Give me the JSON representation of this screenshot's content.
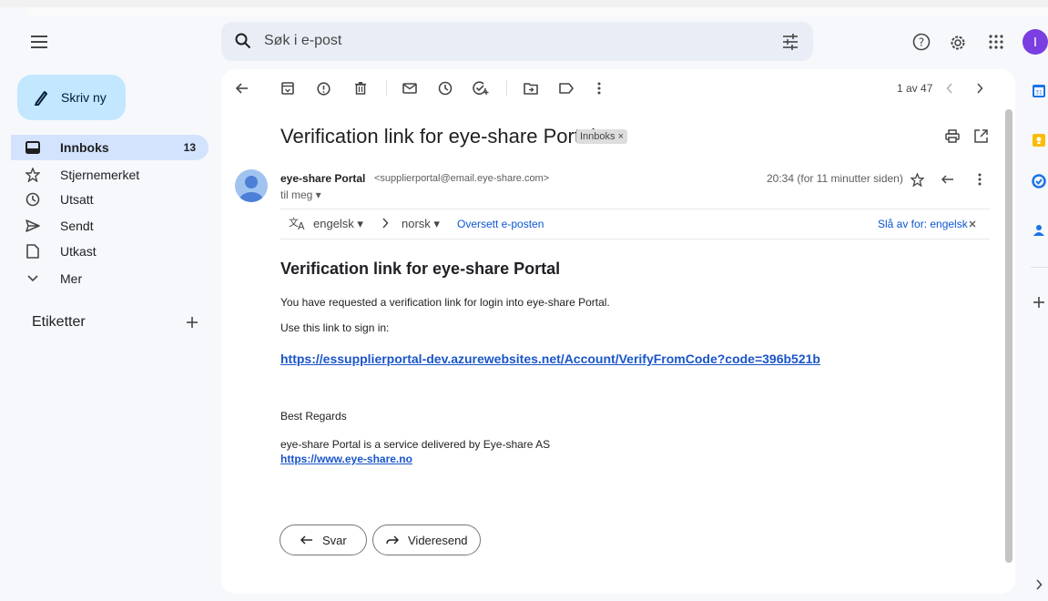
{
  "search": {
    "placeholder": "Søk i e-post"
  },
  "compose": {
    "label": "Skriv ny"
  },
  "nav": {
    "items": [
      {
        "label": "Innboks",
        "count": "13"
      },
      {
        "label": "Stjernemerket"
      },
      {
        "label": "Utsatt"
      },
      {
        "label": "Sendt"
      },
      {
        "label": "Utkast"
      },
      {
        "label": "Mer"
      }
    ],
    "labels_title": "Etiketter"
  },
  "account": {
    "initial": "I"
  },
  "toolbar": {
    "pager": "1 av 47"
  },
  "email": {
    "subject": "Verification link for eye-share Portal",
    "label_chip": "Innboks ×",
    "sender_name": "eye-share Portal",
    "sender_email": "<supplierportal@email.eye-share.com>",
    "to": "til meg ▾",
    "time": "20:34 (for 11 minutter siden)",
    "translate": {
      "from": "engelsk",
      "to": "norsk",
      "action": "Oversett e-posten",
      "disable": "Slå av for: engelsk"
    },
    "body": {
      "heading": "Verification link for eye-share Portal",
      "p1": "You have requested a verification link for login into eye-share Portal.",
      "p2": "Use this link to sign in:",
      "link": "https://essupplierportal-dev.azurewebsites.net/Account/VerifyFromCode?code=396b521b",
      "regards": "Best Regards",
      "footer": "eye-share Portal is a service delivered by Eye-share AS",
      "footer_link": "https://www.eye-share.no"
    },
    "actions": {
      "reply": "Svar",
      "forward": "Videresend"
    }
  },
  "colors": {
    "accent": "#0b57d0",
    "compose_bg": "#c2e7ff",
    "active_nav": "#d3e3fd",
    "avatar": "#7b3ee0"
  }
}
